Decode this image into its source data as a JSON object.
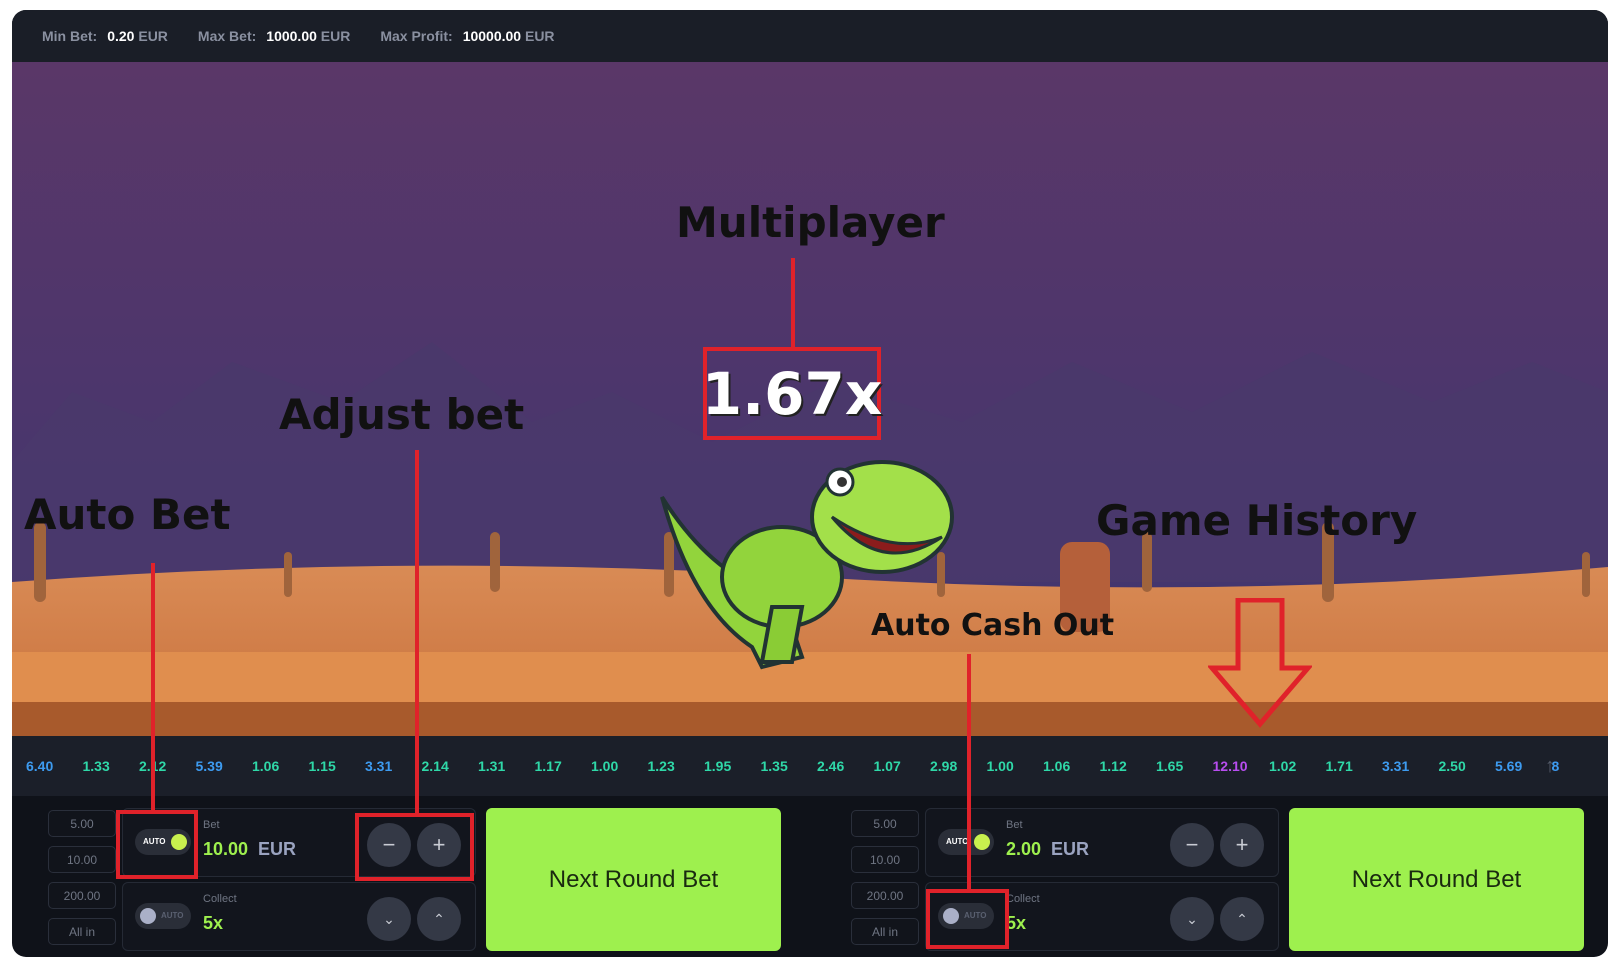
{
  "limits": {
    "min_bet_label": "Min Bet:",
    "min_bet": "0.20",
    "max_bet_label": "Max Bet:",
    "max_bet": "1000.00",
    "max_profit_label": "Max Profit:",
    "max_profit": "10000.00",
    "currency": "EUR"
  },
  "game": {
    "multiplier": "1.67x"
  },
  "history": [
    {
      "v": "6.40",
      "c": "#3d9bf0"
    },
    {
      "v": "1.33",
      "c": "#2fd8a8"
    },
    {
      "v": "2.12",
      "c": "#2fd8a8"
    },
    {
      "v": "5.39",
      "c": "#3d9bf0"
    },
    {
      "v": "1.06",
      "c": "#2fd8a8"
    },
    {
      "v": "1.15",
      "c": "#2fd8a8"
    },
    {
      "v": "3.31",
      "c": "#3d9bf0"
    },
    {
      "v": "2.14",
      "c": "#2fd8a8"
    },
    {
      "v": "1.31",
      "c": "#2fd8a8"
    },
    {
      "v": "1.17",
      "c": "#2fd8a8"
    },
    {
      "v": "1.00",
      "c": "#2fd8a8"
    },
    {
      "v": "1.23",
      "c": "#2fd8a8"
    },
    {
      "v": "1.95",
      "c": "#2fd8a8"
    },
    {
      "v": "1.35",
      "c": "#2fd8a8"
    },
    {
      "v": "2.46",
      "c": "#2fd8a8"
    },
    {
      "v": "1.07",
      "c": "#2fd8a8"
    },
    {
      "v": "2.98",
      "c": "#2fd8a8"
    },
    {
      "v": "1.00",
      "c": "#2fd8a8"
    },
    {
      "v": "1.06",
      "c": "#2fd8a8"
    },
    {
      "v": "1.12",
      "c": "#2fd8a8"
    },
    {
      "v": "1.65",
      "c": "#2fd8a8"
    },
    {
      "v": "12.10",
      "c": "#b84df0"
    },
    {
      "v": "1.02",
      "c": "#2fd8a8"
    },
    {
      "v": "1.71",
      "c": "#2fd8a8"
    },
    {
      "v": "3.31",
      "c": "#3d9bf0"
    },
    {
      "v": "2.50",
      "c": "#2fd8a8"
    },
    {
      "v": "5.69",
      "c": "#3d9bf0"
    },
    {
      "v": "8",
      "c": "#3d9bf0"
    }
  ],
  "panels": [
    {
      "presets": [
        "5.00",
        "10.00",
        "200.00",
        "All in"
      ],
      "auto_label": "AUTO",
      "bet_label": "Bet",
      "bet_value": "10.00",
      "currency": "EUR",
      "collect_label": "Collect",
      "collect_value": "5x",
      "button": "Next Round Bet",
      "auto_bet_on": true,
      "auto_cashout_on": false
    },
    {
      "presets": [
        "5.00",
        "10.00",
        "200.00",
        "All in"
      ],
      "auto_label": "AUTO",
      "bet_label": "Bet",
      "bet_value": "2.00",
      "currency": "EUR",
      "collect_label": "Collect",
      "collect_value": "5x",
      "button": "Next Round Bet",
      "auto_bet_on": true,
      "auto_cashout_on": false
    }
  ],
  "annotations": {
    "multiplier": "Multiplayer",
    "adjust_bet": "Adjust bet",
    "auto_bet": "Auto Bet",
    "game_history": "Game History",
    "auto_cash_out": "Auto Cash Out"
  },
  "colors": {
    "accent": "#9ef04e",
    "annotation": "#e0222a"
  }
}
